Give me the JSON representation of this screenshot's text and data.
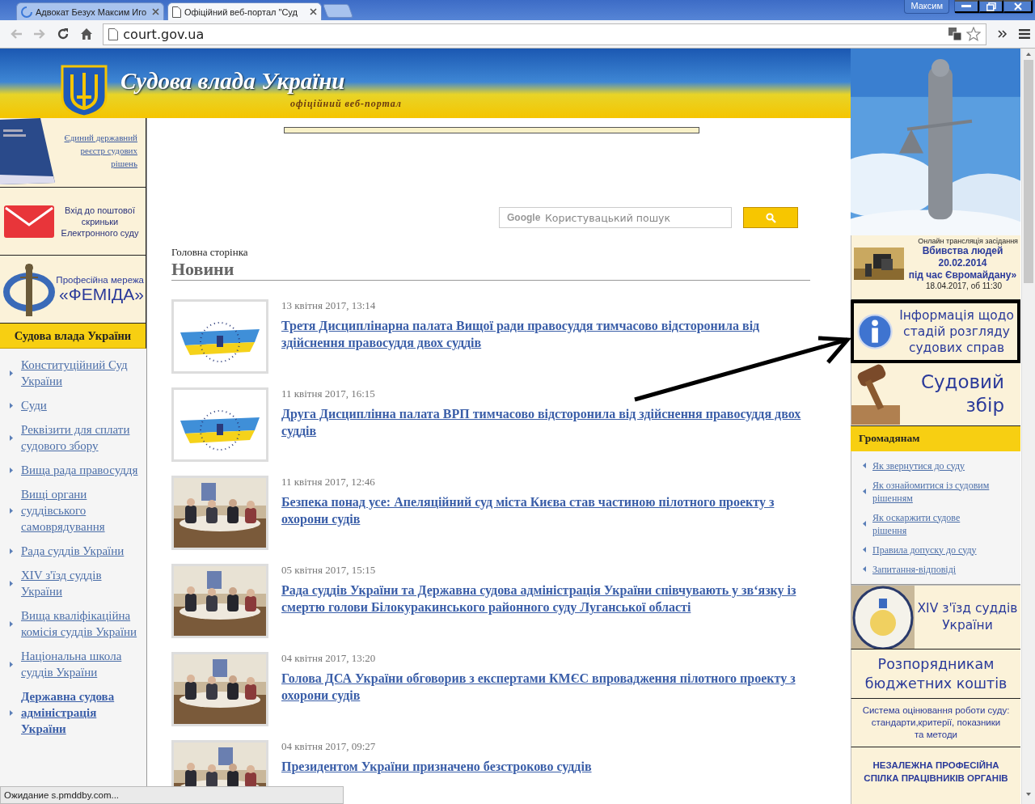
{
  "browser": {
    "tabs": [
      {
        "title": "Адвокат Безух Максим Иго",
        "selected": false,
        "loading": true
      },
      {
        "title": "Офіційний веб-портал \"Суд",
        "selected": true,
        "loading": false
      }
    ],
    "user": "Максим",
    "address": "court.gov.ua",
    "status": "Ожидание s.pmddby.com..."
  },
  "header": {
    "title": "Судова влада України",
    "subtitle": "офіційний веб-портал"
  },
  "left_banners": [
    {
      "kind": "registry",
      "lines": [
        "Єдиний державний",
        "реєстр судових",
        "рішень"
      ]
    },
    {
      "kind": "mail",
      "lines": [
        "Вхід до поштової",
        "скриньки",
        "Електронного суду"
      ]
    },
    {
      "kind": "femida",
      "lines": [
        "Професійна мережа",
        "«ФЕМІДА»"
      ]
    }
  ],
  "left_menu": {
    "title": "Судова влада України",
    "items": [
      {
        "label": "Конституційний Суд України",
        "emphasized": false
      },
      {
        "label": "Суди",
        "emphasized": false
      },
      {
        "label": "Реквізити для сплати судового збору",
        "emphasized": false
      },
      {
        "label": "Вища рада правосуддя",
        "emphasized": false
      },
      {
        "label": "Вищі органи суддівського самоврядування",
        "emphasized": false
      },
      {
        "label": "Рада суддів України",
        "emphasized": false
      },
      {
        "label": "XIV з'їзд суддів України",
        "emphasized": false
      },
      {
        "label": "Вища кваліфікаційна комісія суддів України",
        "emphasized": false
      },
      {
        "label": "Національна школа суддів України",
        "emphasized": false
      },
      {
        "label": "Державна судова адміністрація України",
        "emphasized": true
      }
    ]
  },
  "search": {
    "brand": "Google",
    "placeholder": "Користувацький пошук"
  },
  "breadcrumb": "Головна сторінка",
  "news_heading": "Новини",
  "news": [
    {
      "date": "13 квітня 2017, 13:14",
      "title": "Третя Дисциплінарна палата Вищої ради правосуддя тимчасово відсторонила від здійснення правосуддя двох суддів"
    },
    {
      "date": "11 квітня 2017, 16:15",
      "title": "Друга Дисциплінна палата ВРП тимчасово відсторонила від здійснення правосуддя двох суддів"
    },
    {
      "date": "11 квітня 2017, 12:46",
      "title": "Безпека понад усе: Апеляційний суд міста Києва став частиною пілотного проекту з охорони судів"
    },
    {
      "date": "05 квітня 2017, 15:15",
      "title": "Рада суддів України та Державна судова адміністрація України співчувають у зв‘язку із смертю голови Білокуракинського районного суду Луганської області"
    },
    {
      "date": "04 квітня 2017, 13:20",
      "title": "Голова ДСА України обговорив з експертами КМЄС впровадження пілотного проекту з охорони судів"
    },
    {
      "date": "04 квітня 2017, 09:27",
      "title": "Президентом України призначено безстроково суддів"
    }
  ],
  "right": {
    "live": {
      "caption": "Онлайн трансляція засідання",
      "lines": [
        "Вбивства  людей",
        "20.02.2014",
        "під час Євромайдану»"
      ],
      "when": "18.04.2017, об 11:30"
    },
    "info": {
      "lines": [
        "Інформація щодо",
        "стадій розгляду",
        "судових справ"
      ],
      "highlighted": true
    },
    "fee": {
      "lines": [
        "Судовий",
        "збір"
      ]
    },
    "citizens": {
      "title": "Громадянам",
      "links": [
        "Як звернутися до суду",
        "Як ознайомитися із судовим рішенням",
        "Як оскаржити судове рішення",
        "Правила допуску до суду",
        "Запитання-відповіді"
      ]
    },
    "congress": {
      "lines": [
        "XIV з'їзд суддів",
        "України"
      ]
    },
    "budget": {
      "lines": [
        "Розпорядникам",
        "бюджетних коштів"
      ]
    },
    "evaluation": {
      "lines": [
        "Система оцінювання роботи суду:",
        "стандарти,критерії, показники",
        "та методи"
      ]
    },
    "union": {
      "lines": [
        "НЕЗАЛЕЖНА ПРОФЕСІЙНА",
        "СПІЛКА ПРАЦІВНИКІВ ОРГАНІВ"
      ]
    }
  }
}
